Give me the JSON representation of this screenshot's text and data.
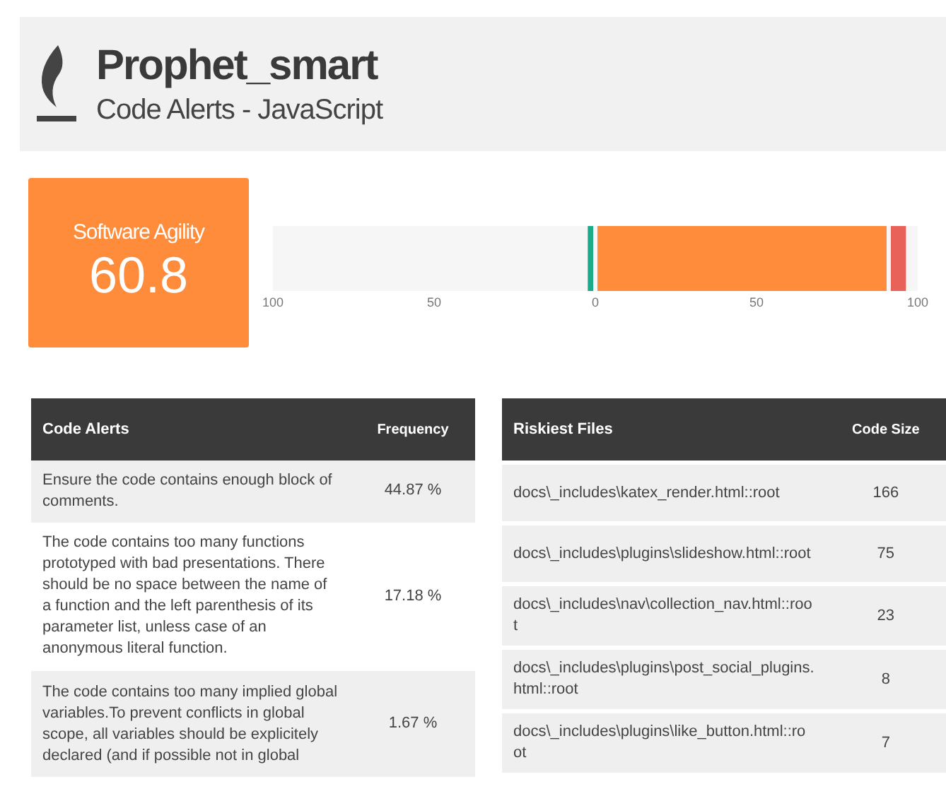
{
  "header": {
    "title": "Prophet_smart",
    "subtitle": "Code Alerts - JavaScript"
  },
  "score": {
    "label": "Software Agility",
    "value": "60.8"
  },
  "chart": {
    "chart_data": {
      "type": "bar",
      "orientation": "horizontal",
      "stacked": true,
      "xlim": [
        -100,
        100
      ],
      "xticks": [
        {
          "value": -100,
          "label": "100"
        },
        {
          "value": -50,
          "label": "50"
        },
        0,
        50,
        100
      ],
      "series": [
        {
          "color": "#1aab8a",
          "values": [
            -3
          ]
        },
        {
          "color": "#ff8c3a",
          "values": [
            91
          ]
        },
        {
          "color": "#e8625a",
          "values": [
            6
          ]
        }
      ]
    }
  },
  "alerts_table": {
    "columns": [
      "Code Alerts",
      "Frequency"
    ],
    "rows": [
      {
        "alert": "Ensure the code contains enough block of comments.",
        "frequency": "44.87 %"
      },
      {
        "alert": "The code contains too many functions prototyped with bad presentations. There should be no space between the name of a function and the left parenthesis of its parameter list, unless case of an anonymous literal function.",
        "frequency": "17.18 %"
      },
      {
        "alert": "The code contains too many implied global variables.To prevent conflicts in global scope, all variables should be explicitely declared (and if possible not in global",
        "frequency": "1.67 %"
      }
    ]
  },
  "files_table": {
    "columns": [
      "Riskiest Files",
      "Code Size"
    ],
    "rows": [
      {
        "file": "docs\\_includes\\katex_render.html::root",
        "size": "166"
      },
      {
        "file": "docs\\_includes\\plugins\\slideshow.html::root",
        "size": "75"
      },
      {
        "file": "docs\\_includes\\nav\\collection_nav.html::roo t",
        "size": "23"
      },
      {
        "file": "docs\\_includes\\plugins\\post_social_plugins. html::root",
        "size": "8"
      },
      {
        "file": "docs\\_includes\\plugins\\like_button.html::ro ot",
        "size": "7"
      }
    ]
  }
}
